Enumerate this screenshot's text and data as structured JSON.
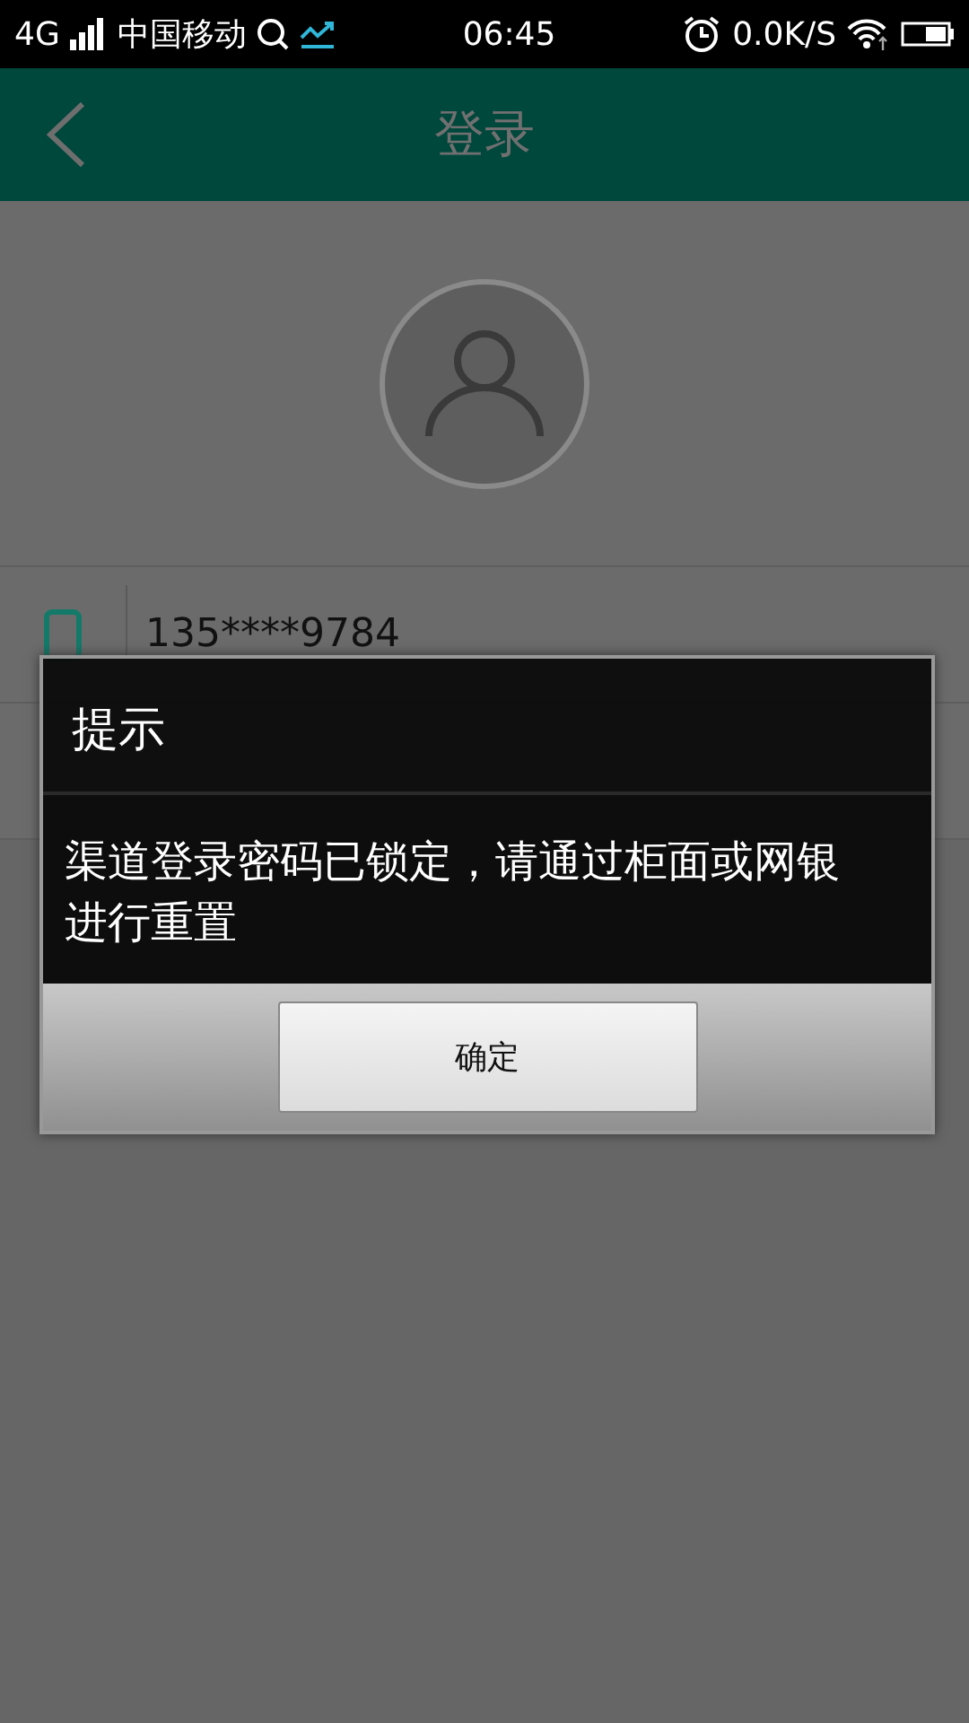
{
  "status_bar": {
    "network": "4G",
    "carrier": "中国移动",
    "time": "06:45",
    "speed": "0.0K/S"
  },
  "header": {
    "title": "登录"
  },
  "form": {
    "phone": "135****9784"
  },
  "dialog": {
    "title": "提示",
    "message": "渠道登录密码已锁定，请通过柜面或网银进行重置",
    "buttons": [
      "确定"
    ]
  }
}
